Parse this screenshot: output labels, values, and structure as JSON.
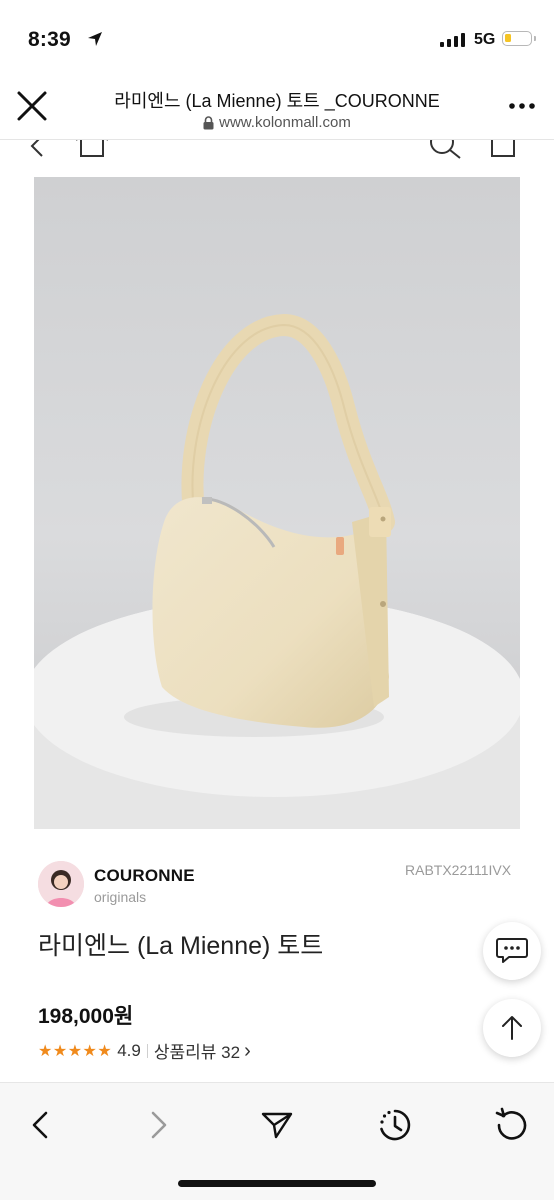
{
  "status": {
    "time": "8:39",
    "network": "5G"
  },
  "header": {
    "title": "라미엔느 (La Mienne) 토트 _COURONNE",
    "url": "www.kolonmall.com"
  },
  "product": {
    "brand_name": "COURONNE",
    "brand_sub": "originals",
    "code": "RABTX22111IVX",
    "name": "라미엔느 (La Mienne) 토트",
    "price": "198,000원",
    "stars": "★★★★★",
    "rating": "4.9",
    "review_text": "상품리뷰 32",
    "review_chevron": "›"
  },
  "colors": {
    "accent_star": "#f08a1c",
    "battery": "#f5c425"
  },
  "icons": [
    "close-icon",
    "lock-icon",
    "more-icon",
    "chat-icon",
    "arrow-up-icon",
    "back-icon",
    "forward-icon",
    "share-icon",
    "timer-icon",
    "reload-icon"
  ]
}
